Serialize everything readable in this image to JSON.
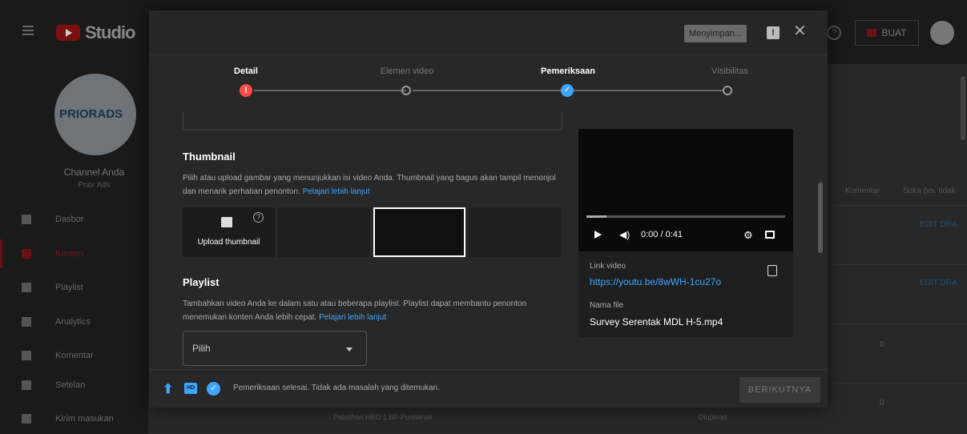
{
  "app": {
    "logo_text": "Studio"
  },
  "topbar": {
    "create_label": "BUAT"
  },
  "sidebar": {
    "brand_text": "PRIORADS",
    "channel_title": "Channel Anda",
    "channel_name": "Prior Ads",
    "items": [
      {
        "label": "Dasbor"
      },
      {
        "label": "Konten",
        "active": true
      },
      {
        "label": "Playlist"
      },
      {
        "label": "Analytics"
      },
      {
        "label": "Komentar"
      },
      {
        "label": "Setelan"
      },
      {
        "label": "Kirim masukan"
      }
    ]
  },
  "background_table": {
    "col_comments": "Komentar",
    "col_likes": "Suka (vs. tidak",
    "edit_draft": "EDIT DRA",
    "zero": "0",
    "row_title": "Pelatihan HRD 1 BP Pontianak",
    "row_status": "Diupload"
  },
  "dialog": {
    "saving_label": "Menyimpan...",
    "steps": [
      {
        "label": "Detail",
        "state": "error"
      },
      {
        "label": "Elemen video",
        "state": "pending"
      },
      {
        "label": "Pemeriksaan",
        "state": "done"
      },
      {
        "label": "Visibilitas",
        "state": "pending"
      }
    ],
    "thumbnail": {
      "title": "Thumbnail",
      "desc": "Pilih atau upload gambar yang menunjukkan isi video Anda. Thumbnail yang bagus akan tampil menonjol dan menarik perhatian penonton.",
      "learn_more": "Pelajari lebih lanjut",
      "upload_label": "Upload thumbnail"
    },
    "playlist": {
      "title": "Playlist",
      "desc": "Tambahkan video Anda ke dalam satu atau beberapa playlist. Playlist dapat membantu penonton menemukan konten Anda lebih cepat.",
      "learn_more": "Pelajari lebih lanjut",
      "select_value": "Pilih"
    },
    "video": {
      "time": "0:00 / 0:41",
      "link_label": "Link video",
      "link_value": "https://youtu.be/8wWH-1cu27o",
      "file_label": "Nama file",
      "file_value": "Survey Serentak MDL H-5.mp4"
    },
    "footer": {
      "hd_badge": "HD",
      "status_text": "Pemeriksaan selesai. Tidak ada masalah yang ditemukan.",
      "next_label": "BERIKUTNYA"
    }
  }
}
